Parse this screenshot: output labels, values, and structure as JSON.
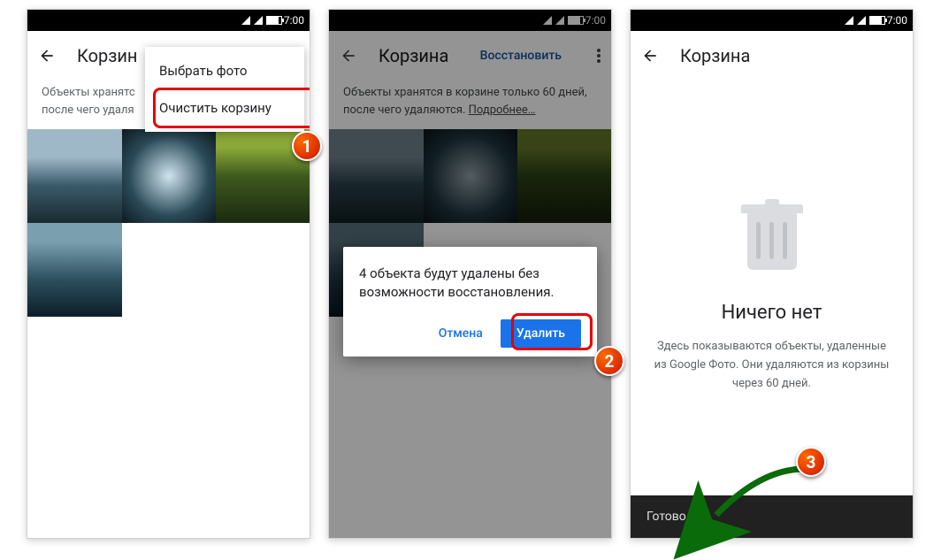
{
  "status": {
    "time": "7:00"
  },
  "screen1": {
    "title": "Корзина",
    "truncated_title": "Корзин",
    "info_p1": "Объекты хранятс",
    "info_p2": "после чего удаля",
    "menu": {
      "select": "Выбрать фото",
      "clear": "Очистить корзину"
    }
  },
  "screen2": {
    "title": "Корзина",
    "restore": "Восстановить",
    "info": "Объекты хранятся в корзине только 60 дней, после чего удаляются.",
    "info_link": "Подробнее…",
    "dialog_msg": "4 объекта будут удалены без возможности восстановления.",
    "cancel": "Отмена",
    "delete": "Удалить"
  },
  "screen3": {
    "title": "Корзина",
    "empty_title": "Ничего нет",
    "empty_body": "Здесь показываются объекты, удаленные из Google Фото. Они удаляются из корзины через 60 дней.",
    "snackbar": "Готово"
  },
  "steps": {
    "s1": "1",
    "s2": "2",
    "s3": "3"
  }
}
